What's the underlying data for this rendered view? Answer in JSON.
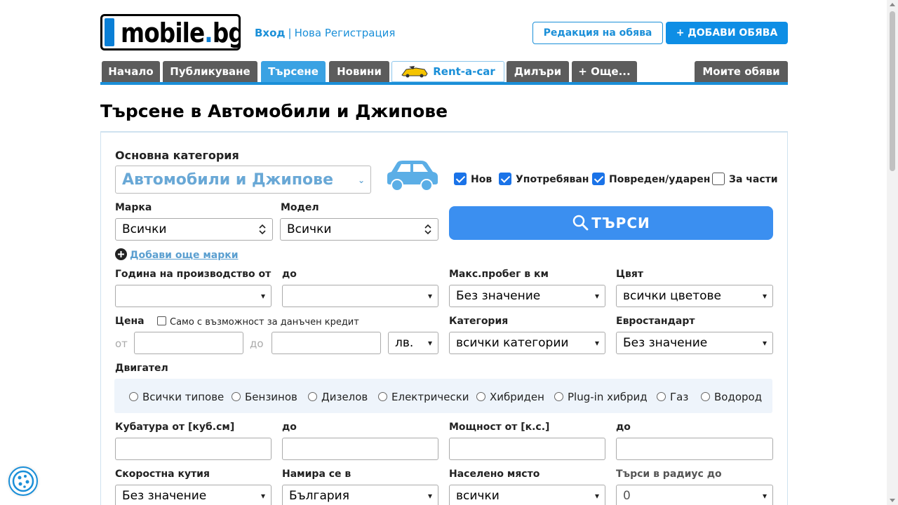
{
  "header": {
    "logo_text": "mobile",
    "logo_dot": ".",
    "logo_tld": "bg",
    "login": "Вход",
    "separator": "|",
    "register": "Нова Регистрация",
    "edit_ad": "Редакция на обява",
    "add_ad": "+ ДОБАВИ ОБЯВА"
  },
  "nav": {
    "tabs": [
      {
        "label": "Начало"
      },
      {
        "label": "Публикуване"
      },
      {
        "label": "Търсене"
      },
      {
        "label": "Новини"
      },
      {
        "label": "Rent-a-car"
      },
      {
        "label": "Дилъри"
      },
      {
        "label": "+ Още..."
      }
    ],
    "my_ads": "Моите обяви",
    "active_tab": "Търсене"
  },
  "page_title": "Търсене в Автомобили и Джипове",
  "form": {
    "main_category_label": "Основна категория",
    "main_category_value": "Автомобили и Джипове",
    "conditions": [
      {
        "label": "Нов",
        "checked": true
      },
      {
        "label": "Употребяван",
        "checked": true
      },
      {
        "label": "Повреден/ударен",
        "checked": true
      },
      {
        "label": "За части",
        "checked": false
      }
    ],
    "brand_label": "Марка",
    "brand_value": "Всички",
    "model_label": "Модел",
    "model_value": "Всички",
    "search_button": "ТЪРСИ",
    "add_brands": "Добави още марки",
    "year_from_label": "Година на производство от",
    "year_to_label": "до",
    "year_from_value": "",
    "year_to_value": "",
    "mileage_label": "Макс.пробег в км",
    "mileage_value": "Без значение",
    "color_label": "Цвят",
    "color_value": "всички цветове",
    "price_label": "Цена",
    "tax_credit_label": "Само с възможност за данъчен кредит",
    "price_from_label": "от",
    "price_to_label": "до",
    "currency_value": "лв.",
    "category_label": "Категория",
    "category_value": "всички категории",
    "eurostandard_label": "Евростандарт",
    "eurostandard_value": "Без значение",
    "engine_label": "Двигател",
    "engine_types": [
      "Всички типове",
      "Бензинов",
      "Дизелов",
      "Електрически",
      "Хибриден",
      "Plug-in хибрид",
      "Газ",
      "Водород"
    ],
    "cc_from_label": "Кубатура от [куб.см]",
    "cc_to_label": "до",
    "power_from_label": "Мощност от [к.с.]",
    "power_to_label": "до",
    "gearbox_label": "Скоростна кутия",
    "gearbox_value": "Без значение",
    "location_label": "Намира се в",
    "location_value": "България",
    "city_label": "Населено място",
    "city_value": "всички",
    "radius_label": "Търси в радиус до",
    "radius_value": "0"
  },
  "colors": {
    "accent": "#1a8fd8",
    "nav_bg": "#5c5c5c",
    "active_tab": "#3aa2e3",
    "search_btn": "#3b8ff0"
  }
}
